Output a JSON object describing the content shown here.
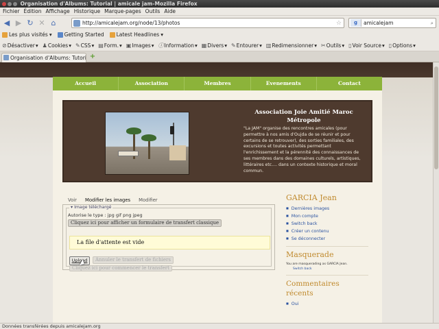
{
  "window": {
    "title": "Organisation d'Albums: Tutorial | amicale jam-Mozilla Firefox"
  },
  "menubar": [
    "Fichier",
    "Édition",
    "Affichage",
    "Historique",
    "Marque-pages",
    "Outils",
    "Aide"
  ],
  "navbar": {
    "url": "http://amicalejam.org/node/13/photos",
    "search_value": "amicalejam"
  },
  "bookmarks": [
    "Les plus visités",
    "Getting Started",
    "Latest Headlines"
  ],
  "devtoolbar": [
    "Désactiver",
    "Cookies",
    "CSS",
    "Form.",
    "Images",
    "Information",
    "Divers",
    "Entourer",
    "Redimensionner",
    "Outils",
    "Voir Source",
    "Options"
  ],
  "tab": {
    "label": "Organisation d'Albums: Tutori..."
  },
  "site_nav": [
    "Accueil",
    "Association",
    "Membres",
    "Evenements",
    "Contact"
  ],
  "banner": {
    "title": "Association Joie Amitié Maroc Métropole",
    "text": "\"La JAM\" organise des rencontres amicales (pour permettre à nos amis d'Oujda de se réunir et pour certains de se retrouver), des sorties familiales, des excursions et toutes activités permettant l'enrichissement et la pérennité des connaissances de ses membres dans des domaines culturels, artistiques, littéraires etc.... dans un contexte historique et moral commun."
  },
  "content_tabs": [
    "Voir",
    "Modifier les images",
    "Modifier"
  ],
  "uploader": {
    "legend": "▾ Image téléchargé",
    "allowed": "Autorise le type : jpg gif png jpeg",
    "classic_button": "Cliquez ici pour afficher un formulaire de transfert classique",
    "queue_text": "La file d'attente est vide",
    "upload_button": "Upload",
    "cancel_button": "Annuler le transfert de fichiers",
    "start_button": "Cliquez ici pour commencer le transfert"
  },
  "sidebar": {
    "user_title": "GARCIA Jean",
    "user_links": [
      "Dernières images",
      "Mon compte",
      "Switch back",
      "Créer un contenu",
      "Se déconnecter"
    ],
    "masq_title": "Masquerade",
    "masq_text": "You are masquerading as GARCIA Jean.",
    "masq_link": "Switch back",
    "comments_title": "Commentaires récents",
    "comments_items": [
      "Oui"
    ]
  },
  "status": {
    "text": "Données transférées depuis amicalejam.org"
  }
}
